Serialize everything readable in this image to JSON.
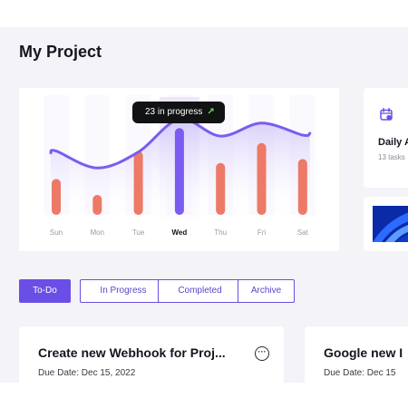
{
  "page": {
    "title": "My Project"
  },
  "chart": {
    "tooltip": {
      "text": "23 in progress",
      "arrow": "↗"
    },
    "highlight_color": "#7b5cf0",
    "bar_color": "#ec7a66",
    "line_color": "#7b5cf0"
  },
  "chart_data": {
    "type": "bar",
    "categories": [
      "Sun",
      "Mon",
      "Tue",
      "Wed",
      "Thu",
      "Fri",
      "Sat"
    ],
    "highlighted": "Wed",
    "series": [
      {
        "values": [
          36,
          20,
          64,
          87,
          52,
          72,
          56
        ]
      },
      {
        "values": [
          64,
          47,
          63,
          96,
          79,
          92,
          80
        ]
      }
    ],
    "ylim": [
      0,
      100
    ],
    "annotation": "23 in progress"
  },
  "side_cards": [
    {
      "title": "Daily A",
      "subtitle": "13 tasks",
      "icon": "calendar-check-icon"
    },
    {
      "icon": "image-thumbnail"
    }
  ],
  "tabs": [
    {
      "label": "To-Do",
      "active": true
    },
    {
      "label": "In Progress",
      "active": false
    },
    {
      "label": "Completed",
      "active": false
    },
    {
      "label": "Archive",
      "active": false
    }
  ],
  "tasks": [
    {
      "title": "Create new Webhook for Proj...",
      "due": "Due Date: Dec 15, 2022",
      "more_icon": "more-horizontal-icon"
    },
    {
      "title": "Google new I",
      "due": "Due Date: Dec 15"
    }
  ]
}
